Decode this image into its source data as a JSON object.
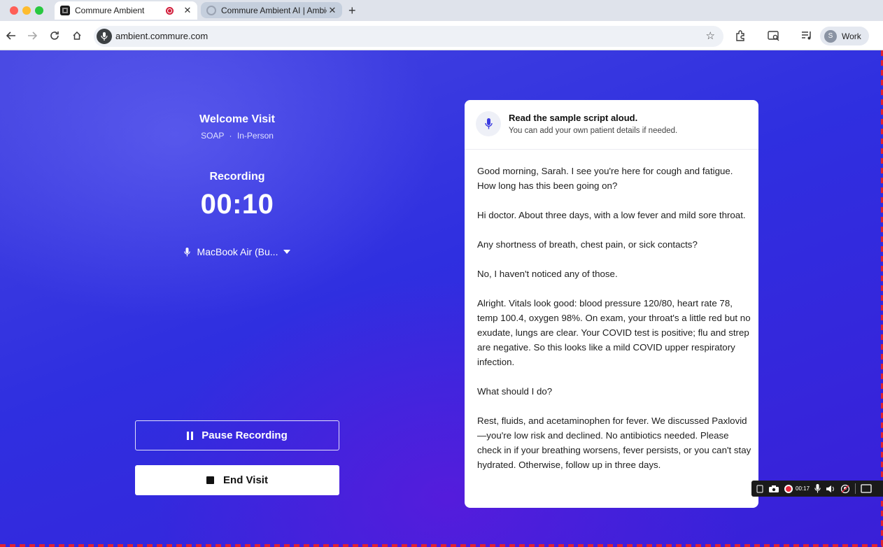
{
  "browser": {
    "tabs": [
      {
        "title": "Commure Ambient",
        "active": true,
        "recording": true
      },
      {
        "title": "Commure Ambient AI | Ambie",
        "active": false,
        "recording": false
      }
    ],
    "new_tab": "+",
    "close_glyph": "✕",
    "url": "ambient.commure.com",
    "profile": {
      "initial": "S",
      "label": "Work"
    }
  },
  "visit": {
    "title": "Welcome Visit",
    "note_type": "SOAP",
    "separator": "·",
    "visit_type": "In-Person"
  },
  "recording": {
    "label": "Recording",
    "timer": "00:10",
    "microphone": "MacBook Air (Bu..."
  },
  "buttons": {
    "pause": "Pause Recording",
    "end": "End Visit"
  },
  "script_card": {
    "title": "Read the sample script aloud.",
    "subtitle": "You can add your own patient details if needed.",
    "paragraphs": [
      "Good morning, Sarah. I see you're here for cough and fatigue. How long has this been going on?",
      "Hi doctor. About three days, with a low fever and mild sore throat.",
      "Any shortness of breath, chest pain, or sick contacts?",
      "No, I haven't noticed any of those.",
      "Alright. Vitals look good: blood pressure 120/80, heart rate 78, temp 100.4, oxygen 98%. On exam, your throat's a little red but no exudate, lungs are clear. Your COVID test is positive; flu and strep are negative. So this looks like a mild COVID upper respiratory infection.",
      "What should I do?",
      "Rest, fluids, and acetaminophen for fever. We discussed Paxlovid—you're low risk and declined. No antibiotics needed. Please check in if your breathing worsens, fever persists, or you can't stay hydrated. Otherwise, follow up in three days."
    ]
  },
  "recorder_overlay": {
    "elapsed": "00:17"
  },
  "colors": {
    "background_accent": "#2f2fe0",
    "record_red": "#d21f3c"
  }
}
